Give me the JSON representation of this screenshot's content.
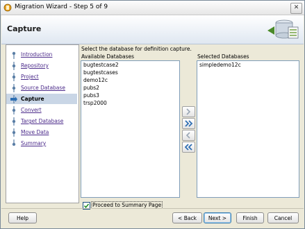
{
  "window": {
    "title": "Migration Wizard - Step 5 of 9",
    "close_glyph": "✕"
  },
  "header": {
    "title": "Capture"
  },
  "nav": {
    "items": [
      {
        "label": "Introduction",
        "state": "link"
      },
      {
        "label": "Repository",
        "state": "link"
      },
      {
        "label": "Project",
        "state": "link"
      },
      {
        "label": "Source Database",
        "state": "link"
      },
      {
        "label": "Capture",
        "state": "current"
      },
      {
        "label": "Convert",
        "state": "link"
      },
      {
        "label": "Target Database",
        "state": "link"
      },
      {
        "label": "Move Data",
        "state": "link"
      },
      {
        "label": "Summary",
        "state": "link"
      }
    ]
  },
  "content": {
    "instruction": "Select the database for definition capture.",
    "available_label": "Available Databases",
    "selected_label": "Selected Databases",
    "available": [
      "bugtestcase2",
      "bugtestcases",
      "demo12c",
      "pubs2",
      "pubs3",
      "trsp2000"
    ],
    "selected": [
      "simpledemo12c"
    ],
    "proceed_label": "Proceed to Summary Page",
    "proceed_checked": true
  },
  "buttons": {
    "help": "Help",
    "back": "< Back",
    "next": "Next >",
    "finish": "Finish",
    "cancel": "Cancel"
  },
  "colors": {
    "accent": "#2f6fb3",
    "link": "#4b2a8a",
    "current_step_bg": "#c9d6e6"
  },
  "icons": {
    "move_right": "chevron-right-icon",
    "move_all_right": "double-chevron-right-icon",
    "move_left": "chevron-left-icon",
    "move_all_left": "double-chevron-left-icon"
  }
}
